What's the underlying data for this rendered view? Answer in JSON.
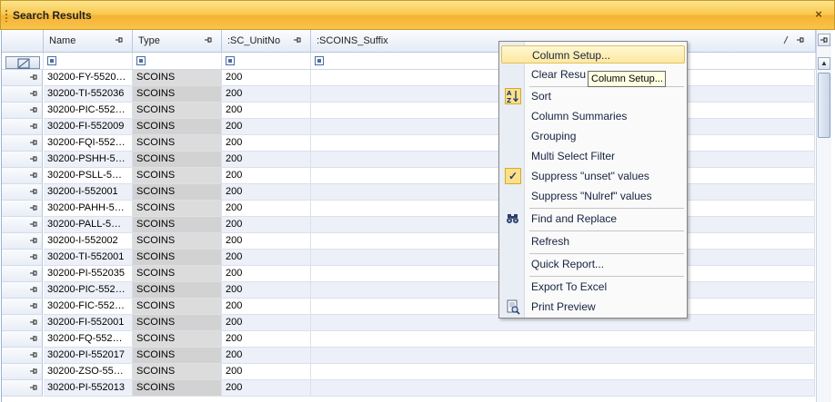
{
  "panel": {
    "title": "Search Results",
    "close_glyph": "×"
  },
  "columns": [
    {
      "key": "name",
      "label": "Name"
    },
    {
      "key": "type",
      "label": "Type"
    },
    {
      "key": "unit",
      "label": ":SC_UnitNo"
    },
    {
      "key": "suffix",
      "label": ":SCOINS_Suffix"
    }
  ],
  "rows": [
    {
      "name": "30200-FY-5520…",
      "type": "SCOINS",
      "unit": "200",
      "suffix": ""
    },
    {
      "name": "30200-TI-552036",
      "type": "SCOINS",
      "unit": "200",
      "suffix": ""
    },
    {
      "name": "30200-PIC-552…",
      "type": "SCOINS",
      "unit": "200",
      "suffix": ""
    },
    {
      "name": "30200-FI-552009",
      "type": "SCOINS",
      "unit": "200",
      "suffix": ""
    },
    {
      "name": "30200-FQI-552…",
      "type": "SCOINS",
      "unit": "200",
      "suffix": ""
    },
    {
      "name": "30200-PSHH-5…",
      "type": "SCOINS",
      "unit": "200",
      "suffix": ""
    },
    {
      "name": "30200-PSLL-5…",
      "type": "SCOINS",
      "unit": "200",
      "suffix": ""
    },
    {
      "name": "30200-I-552001",
      "type": "SCOINS",
      "unit": "200",
      "suffix": ""
    },
    {
      "name": "30200-PAHH-5…",
      "type": "SCOINS",
      "unit": "200",
      "suffix": ""
    },
    {
      "name": "30200-PALL-5…",
      "type": "SCOINS",
      "unit": "200",
      "suffix": ""
    },
    {
      "name": "30200-I-552002",
      "type": "SCOINS",
      "unit": "200",
      "suffix": ""
    },
    {
      "name": "30200-TI-552001",
      "type": "SCOINS",
      "unit": "200",
      "suffix": ""
    },
    {
      "name": "30200-PI-552035",
      "type": "SCOINS",
      "unit": "200",
      "suffix": ""
    },
    {
      "name": "30200-PIC-552…",
      "type": "SCOINS",
      "unit": "200",
      "suffix": ""
    },
    {
      "name": "30200-FIC-552…",
      "type": "SCOINS",
      "unit": "200",
      "suffix": ""
    },
    {
      "name": "30200-FI-552001",
      "type": "SCOINS",
      "unit": "200",
      "suffix": ""
    },
    {
      "name": "30200-FQ-552…",
      "type": "SCOINS",
      "unit": "200",
      "suffix": ""
    },
    {
      "name": "30200-PI-552017",
      "type": "SCOINS",
      "unit": "200",
      "suffix": ""
    },
    {
      "name": "30200-ZSO-55…",
      "type": "SCOINS",
      "unit": "200",
      "suffix": ""
    },
    {
      "name": "30200-PI-552013",
      "type": "SCOINS",
      "unit": "200",
      "suffix": ""
    }
  ],
  "context_menu": {
    "items": [
      {
        "label": "Column Setup...",
        "icon": "",
        "highlighted": true
      },
      {
        "label": "Clear Resu",
        "icon": ""
      },
      {
        "label": "Sort",
        "icon": "sort-az-icon"
      },
      {
        "label": "Column Summaries",
        "icon": ""
      },
      {
        "label": "Grouping",
        "icon": ""
      },
      {
        "label": "Multi Select Filter",
        "icon": ""
      },
      {
        "label": "Suppress \"unset\" values",
        "icon": "check-icon",
        "checked": true
      },
      {
        "label": "Suppress \"Nulref\" values",
        "icon": ""
      },
      {
        "label": "Find and Replace",
        "icon": "binoculars-icon"
      },
      {
        "label": "Refresh",
        "icon": ""
      },
      {
        "label": "Quick Report...",
        "icon": ""
      },
      {
        "label": "Export To Excel",
        "icon": ""
      },
      {
        "label": "Print Preview",
        "icon": "print-preview-icon"
      }
    ]
  },
  "tooltip": {
    "text": "Column Setup..."
  },
  "colors": {
    "title_bar": "#f9c84d",
    "menu_highlight": "#fde8a0",
    "alt_row": "#edf0f8",
    "type_column": "#dcdcdc"
  }
}
